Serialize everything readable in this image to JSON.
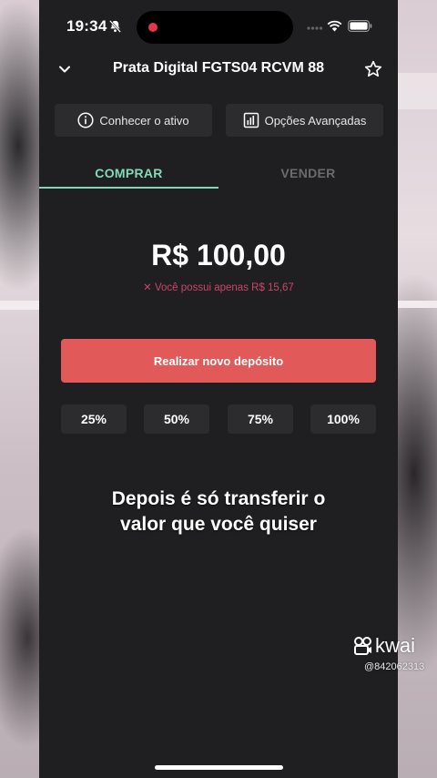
{
  "status_bar": {
    "time": "19:34"
  },
  "header": {
    "title": "Prata Digital FGTS04 RCVM 88"
  },
  "actions": {
    "about_label": "Conhecer o ativo",
    "advanced_label": "Opções Avançadas"
  },
  "tabs": [
    {
      "label": "COMPRAR",
      "active": true
    },
    {
      "label": "VENDER",
      "active": false
    }
  ],
  "order": {
    "amount": "R$ 100,00",
    "warning": "✕ Você possui apenas R$ 15,67",
    "deposit_label": "Realizar novo depósito",
    "percent_options": [
      "25%",
      "50%",
      "75%",
      "100%"
    ]
  },
  "caption": {
    "line1": "Depois é só transferir o",
    "line2": "valor que você quiser"
  },
  "watermark": {
    "brand": "kwai",
    "user_id": "@842062313"
  },
  "colors": {
    "accent_green": "#7fd6b4",
    "deposit_red": "#e15958",
    "warning_pink": "#c9476a",
    "app_bg": "#1f1f21"
  }
}
